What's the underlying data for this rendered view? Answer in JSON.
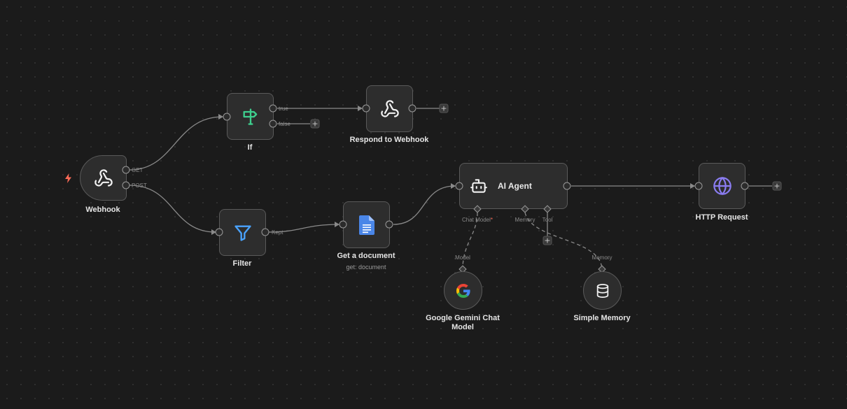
{
  "colors": {
    "canvas": "#1b1b1b",
    "node": "#2d2d2d",
    "edge": "#8a8a8a",
    "trigger": "#ff6b57",
    "if_icon": "#3ecf8e",
    "filter_icon": "#4aa3ff",
    "doc_icon": "#4a86e8",
    "globe_icon": "#8a7cf0"
  },
  "nodes": {
    "webhook": {
      "label": "Webhook",
      "icon": "webhook-icon",
      "outputs": {
        "get": "GET",
        "post": "POST"
      }
    },
    "if": {
      "label": "If",
      "icon": "signpost-icon",
      "outputs": {
        "true": "true",
        "false": "false"
      }
    },
    "respond": {
      "label": "Respond to Webhook",
      "icon": "webhook-icon"
    },
    "filter": {
      "label": "Filter",
      "icon": "funnel-icon",
      "outputs": {
        "kept": "Kept"
      }
    },
    "get_doc": {
      "label": "Get a document",
      "sublabel": "get: document",
      "icon": "google-docs-icon"
    },
    "agent": {
      "label": "AI Agent",
      "icon": "robot-icon",
      "ports": {
        "chat_model": "Chat Model",
        "chat_model_required": "*",
        "memory": "Memory",
        "tool": "Tool"
      }
    },
    "http": {
      "label": "HTTP Request",
      "icon": "globe-icon"
    },
    "gemini": {
      "label": "Google Gemini Chat Model",
      "icon": "google-icon",
      "port": "Model"
    },
    "memory": {
      "label": "Simple Memory",
      "icon": "database-icon",
      "port": "Memory"
    }
  },
  "plus_symbol": "+"
}
